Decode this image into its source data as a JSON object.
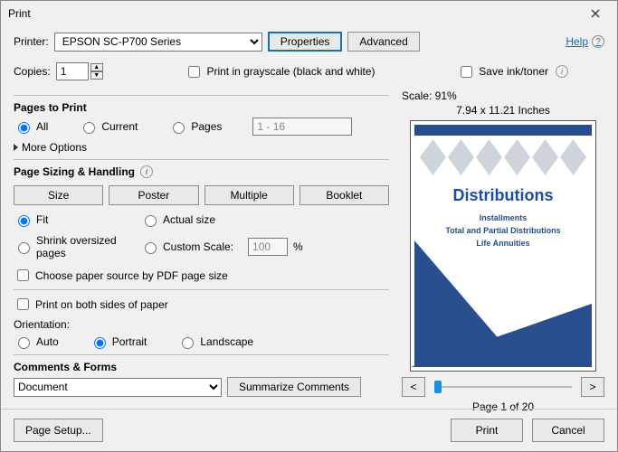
{
  "title": "Print",
  "help": "Help",
  "printer": {
    "label": "Printer:",
    "value": "EPSON SC-P700 Series"
  },
  "buttons": {
    "properties": "Properties",
    "advanced": "Advanced",
    "pagesetup": "Page Setup...",
    "print": "Print",
    "cancel": "Cancel",
    "summarize": "Summarize Comments"
  },
  "copies": {
    "label": "Copies:",
    "value": "1"
  },
  "checks": {
    "grayscale": "Print in grayscale (black and white)",
    "saveink": "Save ink/toner",
    "paperbysize": "Choose paper source by PDF page size",
    "bothsides": "Print on both sides of paper"
  },
  "pagestoprint": {
    "title": "Pages to Print",
    "all": "All",
    "current": "Current",
    "pages": "Pages",
    "range": "1 - 16",
    "more": "More Options"
  },
  "sizing": {
    "title": "Page Sizing & Handling",
    "size": "Size",
    "poster": "Poster",
    "multiple": "Multiple",
    "booklet": "Booklet",
    "fit": "Fit",
    "actual": "Actual size",
    "shrink": "Shrink oversized pages",
    "custom": "Custom Scale:",
    "custom_value": "100",
    "pct": "%"
  },
  "orientation": {
    "title": "Orientation:",
    "auto": "Auto",
    "portrait": "Portrait",
    "landscape": "Landscape"
  },
  "comments": {
    "title": "Comments & Forms",
    "value": "Document"
  },
  "preview": {
    "scale": "Scale:  91%",
    "dims": "7.94 x 11.21 Inches",
    "doc_title": "Distributions",
    "sub1": "Installments",
    "sub2": "Total and Partial Distributions",
    "sub3": "Life Annuities",
    "page": "Page 1 of 20",
    "prev": "<",
    "next": ">"
  }
}
